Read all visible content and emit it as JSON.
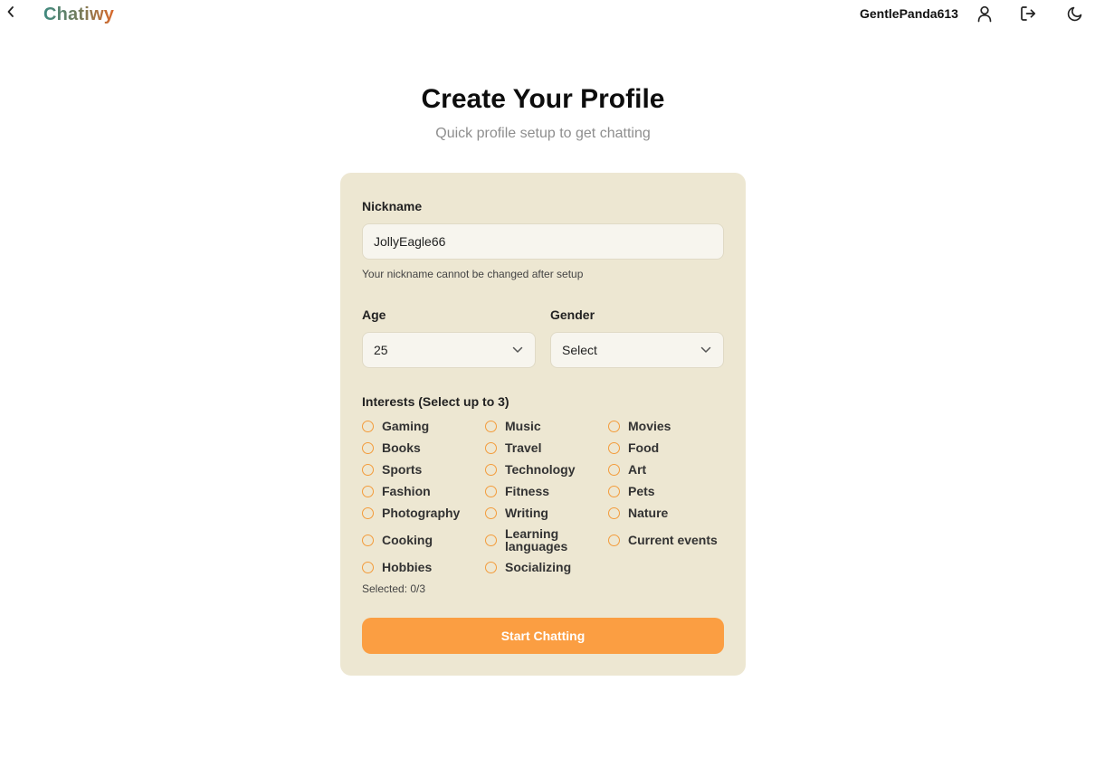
{
  "header": {
    "logo": "Chatiwy",
    "username": "GentlePanda613",
    "icons": {
      "back": "chevron-left-icon",
      "profile": "user-icon",
      "logout": "logout-icon",
      "theme": "moon-icon"
    }
  },
  "page": {
    "title": "Create Your Profile",
    "subtitle": "Quick profile setup to get chatting"
  },
  "form": {
    "nickname": {
      "label": "Nickname",
      "value": "JollyEagle66",
      "hint": "Your nickname cannot be changed after setup"
    },
    "age": {
      "label": "Age",
      "value": "25"
    },
    "gender": {
      "label": "Gender",
      "value": "Select"
    },
    "interests": {
      "label": "Interests (Select up to 3)",
      "items": [
        [
          "Gaming",
          "Music",
          "Movies"
        ],
        [
          "Books",
          "Travel",
          "Food"
        ],
        [
          "Sports",
          "Technology",
          "Art"
        ],
        [
          "Fashion",
          "Fitness",
          "Pets"
        ],
        [
          "Photography",
          "Writing",
          "Nature"
        ],
        [
          "Cooking",
          "Learning languages",
          "Current events"
        ],
        [
          "Hobbies",
          "Socializing"
        ]
      ],
      "counter": "Selected: 0/3"
    },
    "submit_label": "Start Chatting"
  },
  "colors": {
    "accent": "#fb9e42",
    "radio_border": "#f39c3c",
    "card_bg": "#ede7d2",
    "input_bg": "#f7f5ee"
  }
}
